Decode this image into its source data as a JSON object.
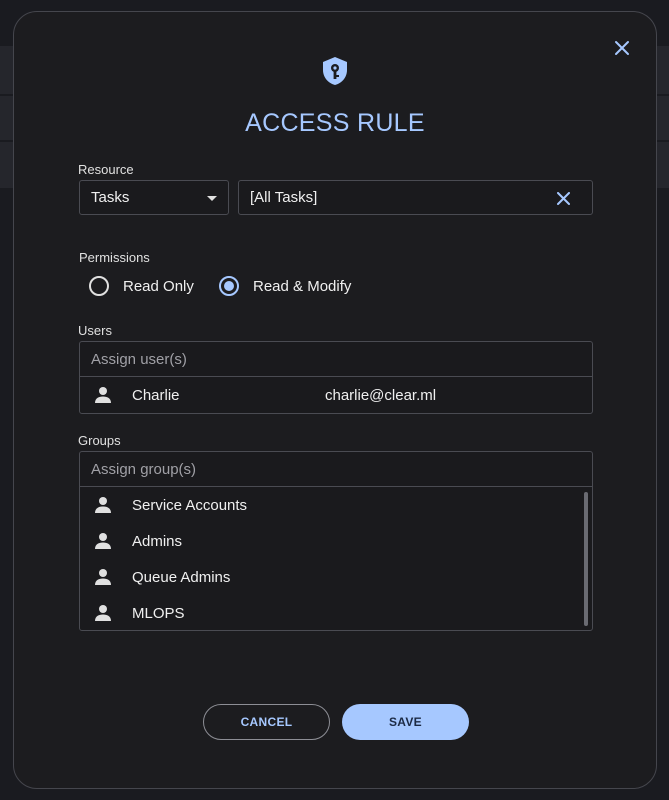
{
  "dialog": {
    "title": "ACCESS RULE",
    "accent_color": "#a6c8ff"
  },
  "resource": {
    "label": "Resource",
    "type_selected": "Tasks",
    "value": "[All Tasks]"
  },
  "permissions": {
    "label": "Permissions",
    "options": [
      {
        "label": "Read Only",
        "checked": false
      },
      {
        "label": "Read & Modify",
        "checked": true
      }
    ]
  },
  "users": {
    "label": "Users",
    "placeholder": "Assign user(s)",
    "items": [
      {
        "name": "Charlie",
        "email": "charlie@clear.ml"
      }
    ]
  },
  "groups": {
    "label": "Groups",
    "placeholder": "Assign group(s)",
    "items": [
      {
        "name": "Service Accounts"
      },
      {
        "name": "Admins"
      },
      {
        "name": "Queue Admins"
      },
      {
        "name": "MLOPS"
      }
    ]
  },
  "actions": {
    "cancel_label": "CANCEL",
    "save_label": "SAVE"
  },
  "icons": {
    "close": "close-icon",
    "shield": "shield-key-icon",
    "clear": "clear-icon",
    "person": "person-icon",
    "caret": "caret-down-icon"
  }
}
